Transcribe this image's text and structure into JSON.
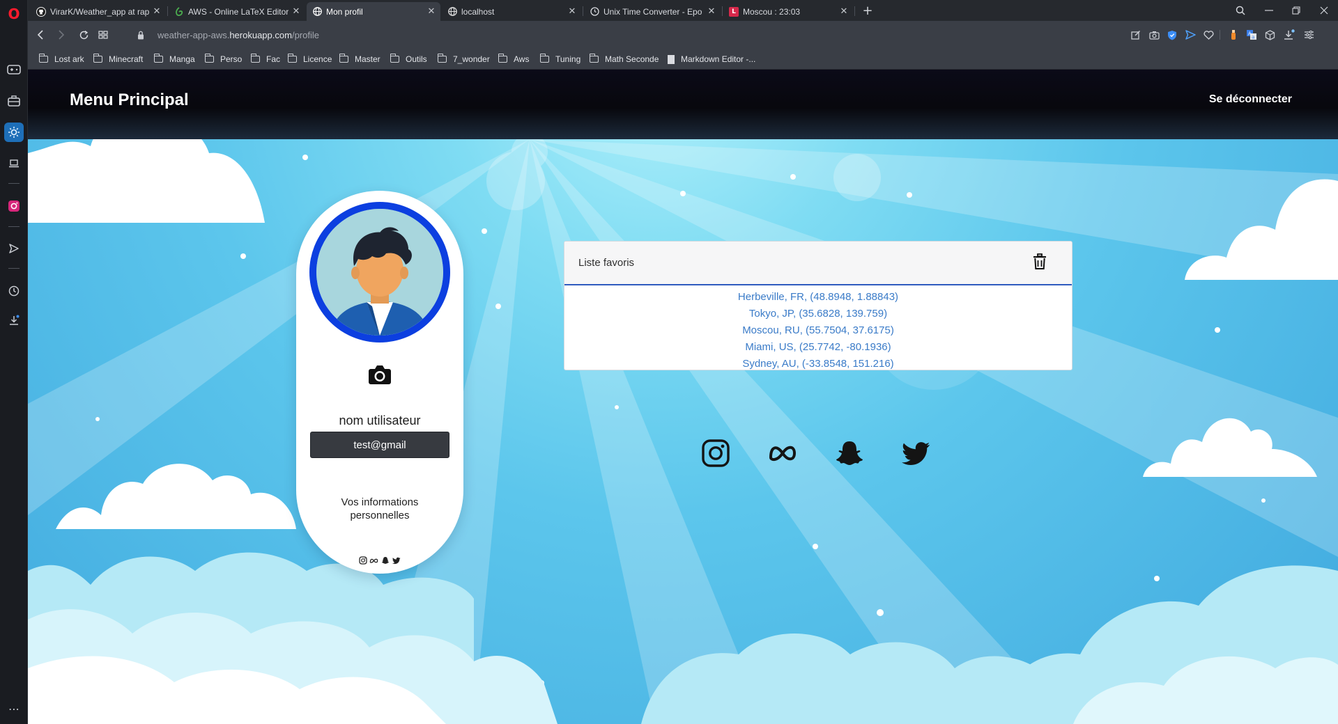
{
  "browser": {
    "tabs": [
      {
        "label": "VirarK/Weather_app at rap",
        "active": false,
        "icon": "github-icon"
      },
      {
        "label": "AWS - Online LaTeX Editor",
        "active": false,
        "icon": "overleaf-icon"
      },
      {
        "label": "Mon profil",
        "active": true,
        "icon": "globe-icon"
      },
      {
        "label": "localhost",
        "active": false,
        "icon": "globe-icon"
      },
      {
        "label": "Unix Time Converter - Epo",
        "active": false,
        "icon": "clock-icon"
      },
      {
        "label": "Moscou : 23:03",
        "active": false,
        "icon": "latex-icon"
      }
    ],
    "new_tab": "+",
    "url_prefix": "weather-app-aws.",
    "url_host": "herokuapp.com",
    "url_path": "/profile",
    "bookmarks": [
      {
        "label": "Lost ark",
        "type": "folder"
      },
      {
        "label": "Minecraft",
        "type": "folder"
      },
      {
        "label": "Manga",
        "type": "folder"
      },
      {
        "label": "Perso",
        "type": "folder"
      },
      {
        "label": "Fac",
        "type": "folder"
      },
      {
        "label": "Licence",
        "type": "folder"
      },
      {
        "label": "Master",
        "type": "folder"
      },
      {
        "label": "Outils",
        "type": "folder"
      },
      {
        "label": "7_wonder",
        "type": "folder"
      },
      {
        "label": "Aws",
        "type": "folder"
      },
      {
        "label": "Tuning",
        "type": "folder"
      },
      {
        "label": "Math Seconde",
        "type": "folder"
      },
      {
        "label": "Markdown Editor -...",
        "type": "page"
      }
    ]
  },
  "page": {
    "brand": "Menu Principal",
    "logout": "Se déconnecter",
    "profile": {
      "username": "nom utilisateur",
      "email": "test@gmail",
      "info_label": "Vos informations personnelles"
    },
    "favorites": {
      "title": "Liste favoris",
      "items": [
        "Herbeville, FR, (48.8948, 1.88843)",
        "Tokyo, JP, (35.6828, 139.759)",
        "Moscou, RU, (55.7504, 37.6175)",
        "Miami, US, (25.7742, -80.1936)",
        "Sydney, AU, (-33.8548, 151.216)"
      ]
    },
    "social_icons": [
      "instagram-icon",
      "meta-icon",
      "snapchat-icon",
      "twitter-icon"
    ]
  },
  "colors": {
    "sky_top": "#b2f1fb",
    "sky_bottom": "#3fa8de",
    "avatar_ring": "#0c3fe0",
    "link": "#3a7bc8",
    "email_box": "#373a40"
  }
}
